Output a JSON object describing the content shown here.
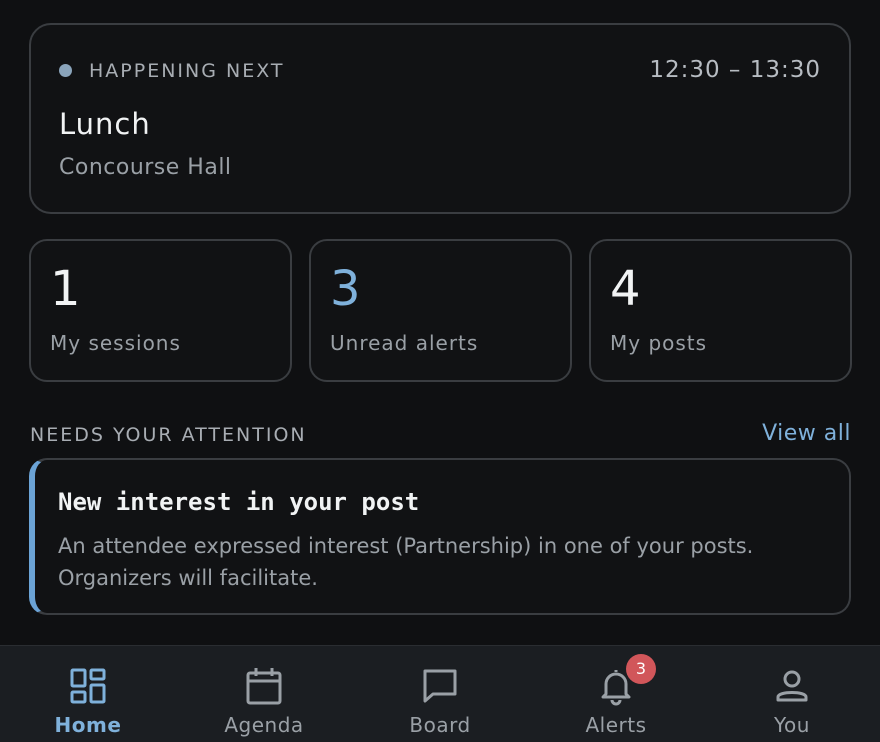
{
  "next": {
    "kicker": "HAPPENING NEXT",
    "time": "12:30 – 13:30",
    "title": "Lunch",
    "location": "Concourse Hall"
  },
  "stats": [
    {
      "value": "1",
      "label": "My sessions"
    },
    {
      "value": "3",
      "label": "Unread alerts"
    },
    {
      "value": "4",
      "label": "My posts"
    }
  ],
  "attention": {
    "title": "NEEDS YOUR ATTENTION",
    "view_all": "View all",
    "card": {
      "title": "New interest in your post",
      "body": "An attendee expressed interest (Partnership) in one of your posts. Organizers will facilitate."
    }
  },
  "nav": {
    "items": [
      {
        "label": "Home",
        "icon": "dashboard-icon"
      },
      {
        "label": "Agenda",
        "icon": "calendar-icon"
      },
      {
        "label": "Board",
        "icon": "chat-bubble-icon"
      },
      {
        "label": "Alerts",
        "icon": "bell-icon",
        "badge": "3"
      },
      {
        "label": "You",
        "icon": "person-icon"
      }
    ]
  },
  "colors": {
    "accent": "#7fb1db",
    "background": "#0f1012",
    "badge": "#d1565a",
    "card_border": "#3a3d41"
  }
}
